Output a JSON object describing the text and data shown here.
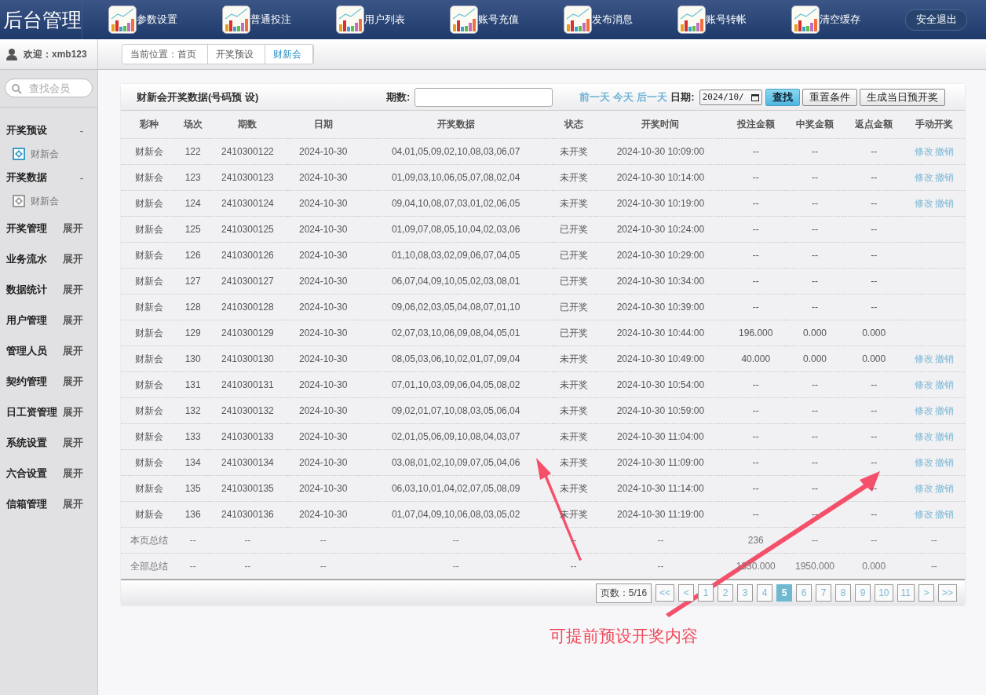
{
  "header": {
    "title": "后台管理",
    "nav": [
      {
        "label": "参数设置"
      },
      {
        "label": "普通投注"
      },
      {
        "label": "用户列表"
      },
      {
        "label": "账号充值"
      },
      {
        "label": "发布消息"
      },
      {
        "label": "账号转帐"
      },
      {
        "label": "清空缓存"
      }
    ],
    "logout": "安全退出"
  },
  "user": {
    "welcome": "欢迎：xmb123"
  },
  "breadcrumb": [
    {
      "label": "当前位置：首页",
      "selected": false
    },
    {
      "label": "开奖预设",
      "selected": false
    },
    {
      "label": "财新会",
      "selected": true
    }
  ],
  "sidebar": {
    "search_placeholder": "查找会员",
    "groups": [
      {
        "label": "开奖预设",
        "toggle": "-",
        "expanded": true,
        "children": [
          {
            "label": "财新会",
            "selected": true
          }
        ]
      },
      {
        "label": "开奖数据",
        "toggle": "-",
        "expanded": true,
        "children": [
          {
            "label": "财新会",
            "selected": false
          }
        ]
      },
      {
        "label": "开奖管理",
        "toggle": "展开",
        "expanded": false
      },
      {
        "label": "业务流水",
        "toggle": "展开",
        "expanded": false
      },
      {
        "label": "数据统计",
        "toggle": "展开",
        "expanded": false
      },
      {
        "label": "用户管理",
        "toggle": "展开",
        "expanded": false
      },
      {
        "label": "管理人员",
        "toggle": "展开",
        "expanded": false
      },
      {
        "label": "契约管理",
        "toggle": "展开",
        "expanded": false
      },
      {
        "label": "日工资管理",
        "toggle": "展开",
        "expanded": false
      },
      {
        "label": "系统设置",
        "toggle": "展开",
        "expanded": false
      },
      {
        "label": "六合设置",
        "toggle": "展开",
        "expanded": false
      },
      {
        "label": "信箱管理",
        "toggle": "展开",
        "expanded": false
      }
    ]
  },
  "panel": {
    "title": "财新会开奖数据(号码预 设)",
    "period_label": "期数:",
    "day_links": [
      "前一天",
      "今天",
      "后一天"
    ],
    "date_label": "日期:",
    "date_value": "2024/10/",
    "buttons": [
      {
        "label": "查找",
        "kind": "primary"
      },
      {
        "label": "重置条件",
        "kind": "plain"
      },
      {
        "label": "生成当日预开奖",
        "kind": "plain"
      }
    ]
  },
  "table": {
    "columns": [
      "彩种",
      "场次",
      "期数",
      "日期",
      "开奖数据",
      "状态",
      "开奖时间",
      "投注金额",
      "中奖金额",
      "返点金额",
      "手动开奖"
    ],
    "rows": [
      {
        "kind": "data",
        "cells": [
          "财新会",
          "122",
          "2410300122",
          "2024-10-30",
          "04,01,05,09,02,10,08,03,06,07",
          "未开奖",
          "2024-10-30 10:09:00",
          "--",
          "--",
          "--"
        ],
        "actions": [
          "修改",
          "撤销"
        ]
      },
      {
        "kind": "data",
        "cells": [
          "财新会",
          "123",
          "2410300123",
          "2024-10-30",
          "01,09,03,10,06,05,07,08,02,04",
          "未开奖",
          "2024-10-30 10:14:00",
          "--",
          "--",
          "--"
        ],
        "actions": [
          "修改",
          "撤销"
        ]
      },
      {
        "kind": "data",
        "cells": [
          "财新会",
          "124",
          "2410300124",
          "2024-10-30",
          "09,04,10,08,07,03,01,02,06,05",
          "未开奖",
          "2024-10-30 10:19:00",
          "--",
          "--",
          "--"
        ],
        "actions": [
          "修改",
          "撤销"
        ]
      },
      {
        "kind": "data",
        "cells": [
          "财新会",
          "125",
          "2410300125",
          "2024-10-30",
          "01,09,07,08,05,10,04,02,03,06",
          "已开奖",
          "2024-10-30 10:24:00",
          "--",
          "--",
          "--"
        ]
      },
      {
        "kind": "data",
        "cells": [
          "财新会",
          "126",
          "2410300126",
          "2024-10-30",
          "01,10,08,03,02,09,06,07,04,05",
          "已开奖",
          "2024-10-30 10:29:00",
          "--",
          "--",
          "--"
        ]
      },
      {
        "kind": "data",
        "cells": [
          "财新会",
          "127",
          "2410300127",
          "2024-10-30",
          "06,07,04,09,10,05,02,03,08,01",
          "已开奖",
          "2024-10-30 10:34:00",
          "--",
          "--",
          "--"
        ]
      },
      {
        "kind": "data",
        "cells": [
          "财新会",
          "128",
          "2410300128",
          "2024-10-30",
          "09,06,02,03,05,04,08,07,01,10",
          "已开奖",
          "2024-10-30 10:39:00",
          "--",
          "--",
          "--"
        ]
      },
      {
        "kind": "data",
        "cells": [
          "财新会",
          "129",
          "2410300129",
          "2024-10-30",
          "02,07,03,10,06,09,08,04,05,01",
          "已开奖",
          "2024-10-30 10:44:00",
          "196.000",
          "0.000",
          "0.000"
        ]
      },
      {
        "kind": "data",
        "cells": [
          "财新会",
          "130",
          "2410300130",
          "2024-10-30",
          "08,05,03,06,10,02,01,07,09,04",
          "未开奖",
          "2024-10-30 10:49:00",
          "40.000",
          "0.000",
          "0.000"
        ],
        "actions": [
          "修改",
          "撤销"
        ]
      },
      {
        "kind": "data",
        "cells": [
          "财新会",
          "131",
          "2410300131",
          "2024-10-30",
          "07,01,10,03,09,06,04,05,08,02",
          "未开奖",
          "2024-10-30 10:54:00",
          "--",
          "--",
          "--"
        ],
        "actions": [
          "修改",
          "撤销"
        ]
      },
      {
        "kind": "data",
        "cells": [
          "财新会",
          "132",
          "2410300132",
          "2024-10-30",
          "09,02,01,07,10,08,03,05,06,04",
          "未开奖",
          "2024-10-30 10:59:00",
          "--",
          "--",
          "--"
        ],
        "actions": [
          "修改",
          "撤销"
        ]
      },
      {
        "kind": "data",
        "cells": [
          "财新会",
          "133",
          "2410300133",
          "2024-10-30",
          "02,01,05,06,09,10,08,04,03,07",
          "未开奖",
          "2024-10-30 11:04:00",
          "--",
          "--",
          "--"
        ],
        "actions": [
          "修改",
          "撤销"
        ]
      },
      {
        "kind": "data",
        "cells": [
          "财新会",
          "134",
          "2410300134",
          "2024-10-30",
          "03,08,01,02,10,09,07,05,04,06",
          "未开奖",
          "2024-10-30 11:09:00",
          "--",
          "--",
          "--"
        ],
        "actions": [
          "修改",
          "撤销"
        ]
      },
      {
        "kind": "data",
        "cells": [
          "财新会",
          "135",
          "2410300135",
          "2024-10-30",
          "06,03,10,01,04,02,07,05,08,09",
          "未开奖",
          "2024-10-30 11:14:00",
          "--",
          "--",
          "--"
        ],
        "actions": [
          "修改",
          "撤销"
        ]
      },
      {
        "kind": "data",
        "cells": [
          "财新会",
          "136",
          "2410300136",
          "2024-10-30",
          "01,07,04,09,10,06,08,03,05,02",
          "未开奖",
          "2024-10-30 11:19:00",
          "--",
          "--",
          "--"
        ],
        "actions": [
          "修改",
          "撤销"
        ]
      },
      {
        "kind": "summary",
        "cells": [
          "本页总结",
          "--",
          "--",
          "--",
          "--",
          "--",
          "--",
          "236",
          "--",
          "--",
          "--"
        ]
      },
      {
        "kind": "summary",
        "cells": [
          "全部总结",
          "--",
          "--",
          "--",
          "--",
          "--",
          "--",
          "1330.000",
          "1950.000",
          "0.000",
          "--"
        ]
      }
    ]
  },
  "pager": {
    "info": "页数：5/16",
    "pages": [
      {
        "label": "<<",
        "selected": false
      },
      {
        "label": "<",
        "selected": false
      },
      {
        "label": "1",
        "selected": false
      },
      {
        "label": "2",
        "selected": false
      },
      {
        "label": "3",
        "selected": false
      },
      {
        "label": "4",
        "selected": false
      },
      {
        "label": "5",
        "selected": true
      },
      {
        "label": "6",
        "selected": false
      },
      {
        "label": "7",
        "selected": false
      },
      {
        "label": "8",
        "selected": false
      },
      {
        "label": "9",
        "selected": false
      },
      {
        "label": "10",
        "selected": false
      },
      {
        "label": "11",
        "selected": false
      },
      {
        "label": ">",
        "selected": false
      },
      {
        "label": ">>",
        "selected": false
      }
    ]
  },
  "annotation": {
    "text": "可提前预设开奖内容"
  }
}
